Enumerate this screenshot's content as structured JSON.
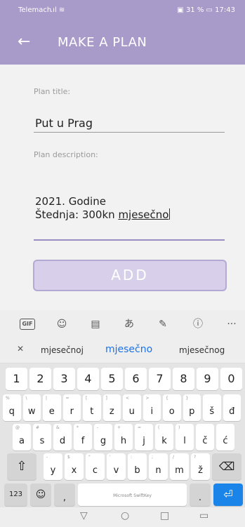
{
  "status": {
    "carrier": "Telemach",
    "signal": "signal-wifi-icons",
    "battery_text": "31 %",
    "time": "17:43"
  },
  "app_bar": {
    "title": "MAKE A PLAN",
    "back_icon": "arrow-left-icon"
  },
  "form": {
    "title_label": "Plan title:",
    "title_value": "Put u Prag",
    "description_label": "Plan description:",
    "description_line1": "2021. Godine",
    "description_line2_prefix": "Štednja: 300kn ",
    "description_line2_word": "mjesečno",
    "add_label": "ADD"
  },
  "keyboard_toolbar": {
    "gif": "GIF",
    "more": "···"
  },
  "suggestions": {
    "left": "mjesečnoj",
    "center": "mjesečno",
    "right": "mjesečnog"
  },
  "keyboard": {
    "numbers": [
      "1",
      "2",
      "3",
      "4",
      "5",
      "6",
      "7",
      "8",
      "9",
      "0"
    ],
    "row1": [
      "q",
      "w",
      "e",
      "r",
      "t",
      "z",
      "u",
      "i",
      "o",
      "p",
      "š",
      "đ"
    ],
    "row1_hints": [
      "%",
      "\\",
      "|",
      "=",
      "[",
      "]",
      "<",
      ">",
      "{",
      "}",
      "",
      ""
    ],
    "row2": [
      "a",
      "s",
      "d",
      "f",
      "g",
      "h",
      "j",
      "k",
      "l",
      "č",
      "ć"
    ],
    "row2_hints": [
      "@",
      "#",
      "&",
      "*",
      "-",
      "+",
      "=",
      "(",
      ")",
      "",
      ""
    ],
    "row3": [
      "y",
      "x",
      "c",
      "v",
      "b",
      "n",
      "m",
      "ž"
    ],
    "row3_hints": [
      "-",
      "$",
      "\"",
      "'",
      ":",
      ";",
      "/",
      "?"
    ],
    "mode_key": "123",
    "comma": ",",
    "space_label": "Microsoft SwiftKey",
    "period": "."
  },
  "colors": {
    "accent": "#a99bc9",
    "enter": "#1a84e8"
  }
}
